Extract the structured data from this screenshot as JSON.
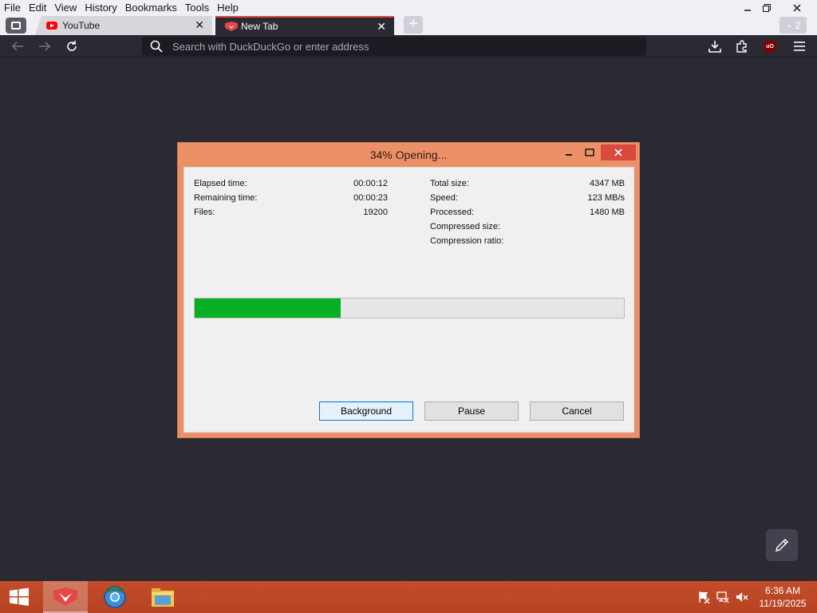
{
  "menubar": {
    "items": [
      "File",
      "Edit",
      "View",
      "History",
      "Bookmarks",
      "Tools",
      "Help"
    ]
  },
  "tabs": [
    {
      "title": "YouTube",
      "active": false,
      "favicon_color": "#ff0000"
    },
    {
      "title": "New Tab",
      "active": true,
      "favicon_color": "#e64646"
    }
  ],
  "tab_count": "2",
  "address_bar": {
    "placeholder": "Search with DuckDuckGo or enter address",
    "value": ""
  },
  "extension_badge": "uO",
  "dialog": {
    "title": "34% Opening...",
    "stats_left": [
      {
        "label": "Elapsed time:",
        "value": "00:00:12"
      },
      {
        "label": "Remaining time:",
        "value": "00:00:23"
      },
      {
        "label": "Files:",
        "value": "19200"
      }
    ],
    "stats_right": [
      {
        "label": "Total size:",
        "value": "4347 MB"
      },
      {
        "label": "Speed:",
        "value": "123 MB/s"
      },
      {
        "label": "Processed:",
        "value": "1480 MB"
      },
      {
        "label": "Compressed size:",
        "value": ""
      },
      {
        "label": "Compression ratio:",
        "value": ""
      }
    ],
    "progress_fraction": 0.34,
    "progress_color": "#06b025",
    "buttons": {
      "background": "Background",
      "pause": "Pause",
      "cancel": "Cancel"
    }
  },
  "taskbar": {
    "time": "6:36 AM",
    "date": "11/19/2025",
    "color": "#c34d2a"
  }
}
